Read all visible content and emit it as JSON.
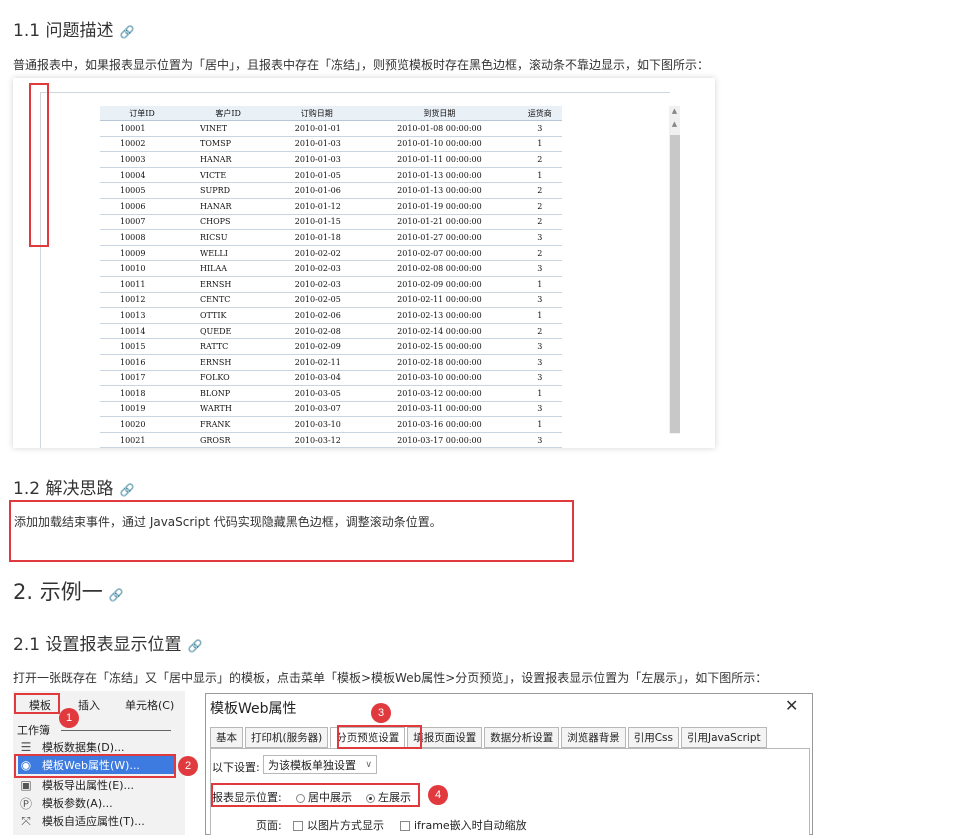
{
  "sections": {
    "s11_title": "1.1 问题描述",
    "s11_text": "普通报表中，如果报表显示位置为「居中」，且报表中存在「冻结」，则预览模板时存在黑色边框，滚动条不靠边显示，如下图所示：",
    "s12_title": "1.2 解决思路",
    "s12_text": "添加加载结束事件，通过 JavaScript 代码实现隐藏黑色边框，调整滚动条位置。",
    "s2_title": "2. 示例一",
    "s21_title": "2.1 设置报表显示位置",
    "s21_text": "打开一张既存在「冻结」又「居中显示」的模板，点击菜单「模板>模板Web属性>分页预览」，设置报表显示位置为「左展示」，如下图所示：",
    "link_icon": "🔗"
  },
  "report_table": {
    "headers": [
      "订单ID",
      "客户ID",
      "订购日期",
      "到货日期",
      "运货商"
    ],
    "rows": [
      [
        "10001",
        "VINET",
        "2010-01-01",
        "2010-01-08 00:00:00",
        "3"
      ],
      [
        "10002",
        "TOMSP",
        "2010-01-03",
        "2010-01-10 00:00:00",
        "1"
      ],
      [
        "10003",
        "HANAR",
        "2010-01-03",
        "2010-01-11 00:00:00",
        "2"
      ],
      [
        "10004",
        "VICTE",
        "2010-01-05",
        "2010-01-13 00:00:00",
        "1"
      ],
      [
        "10005",
        "SUPRD",
        "2010-01-06",
        "2010-01-13 00:00:00",
        "2"
      ],
      [
        "10006",
        "HANAR",
        "2010-01-12",
        "2010-01-19 00:00:00",
        "2"
      ],
      [
        "10007",
        "CHOPS",
        "2010-01-15",
        "2010-01-21 00:00:00",
        "2"
      ],
      [
        "10008",
        "RICSU",
        "2010-01-18",
        "2010-01-27 00:00:00",
        "3"
      ],
      [
        "10009",
        "WELLI",
        "2010-02-02",
        "2010-02-07 00:00:00",
        "2"
      ],
      [
        "10010",
        "HILAA",
        "2010-02-03",
        "2010-02-08 00:00:00",
        "3"
      ],
      [
        "10011",
        "ERNSH",
        "2010-02-03",
        "2010-02-09 00:00:00",
        "1"
      ],
      [
        "10012",
        "CENTC",
        "2010-02-05",
        "2010-02-11 00:00:00",
        "3"
      ],
      [
        "10013",
        "OTTIK",
        "2010-02-06",
        "2010-02-13 00:00:00",
        "1"
      ],
      [
        "10014",
        "QUEDE",
        "2010-02-08",
        "2010-02-14 00:00:00",
        "2"
      ],
      [
        "10015",
        "RATTC",
        "2010-02-09",
        "2010-02-15 00:00:00",
        "3"
      ],
      [
        "10016",
        "ERNSH",
        "2010-02-11",
        "2010-02-18 00:00:00",
        "3"
      ],
      [
        "10017",
        "FOLKO",
        "2010-03-04",
        "2010-03-10 00:00:00",
        "3"
      ],
      [
        "10018",
        "BLONP",
        "2010-03-05",
        "2010-03-12 00:00:00",
        "1"
      ],
      [
        "10019",
        "WARTH",
        "2010-03-07",
        "2010-03-11 00:00:00",
        "3"
      ],
      [
        "10020",
        "FRANK",
        "2010-03-10",
        "2010-03-16 00:00:00",
        "1"
      ],
      [
        "10021",
        "GROSR",
        "2010-03-12",
        "2010-03-17 00:00:00",
        "3"
      ]
    ]
  },
  "menu": {
    "tabs": [
      "模板",
      "插入",
      "单元格(C)"
    ],
    "group_label": "工作簿",
    "items": [
      "模板数据集(D)...",
      "模板Web属性(W)...",
      "模板导出属性(E)...",
      "模板参数(A)...",
      "模板自适应属性(T)..."
    ]
  },
  "dialog": {
    "title": "模板Web属性",
    "close": "✕",
    "tabs": [
      "基本",
      "打印机(服务器)",
      "分页预览设置",
      "填报页面设置",
      "数据分析设置",
      "浏览器背景",
      "引用Css",
      "引用JavaScript"
    ],
    "settings_label": "以下设置:",
    "settings_value": "为该模板单独设置",
    "position_label": "报表显示位置:",
    "position_options": [
      "居中展示",
      "左展示"
    ],
    "position_selected": "左展示",
    "page_label": "页面:",
    "page_options": [
      "以图片方式显示",
      "iframe嵌入时自动缩放"
    ]
  },
  "badges": [
    "1",
    "2",
    "3",
    "4"
  ],
  "colors": {
    "highlight_red": "#e0393e"
  }
}
